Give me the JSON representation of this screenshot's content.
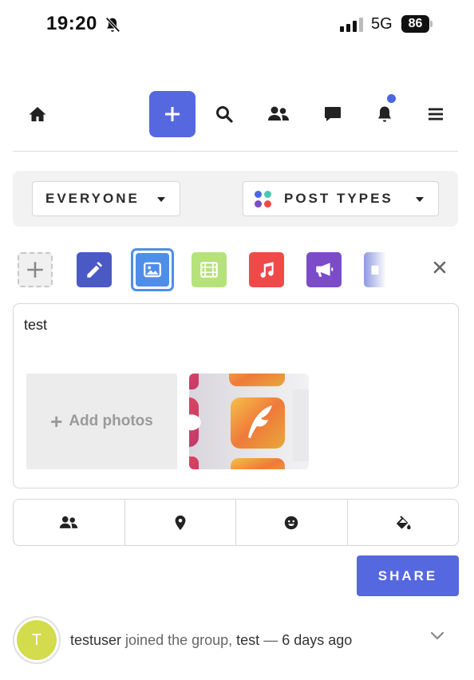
{
  "status_bar": {
    "time": "19:20",
    "network": "5G",
    "battery": "86"
  },
  "nav": {
    "items": [
      "home-icon",
      "plus-icon",
      "search-icon",
      "users-icon",
      "chat-icon",
      "bell-icon",
      "menu-icon"
    ],
    "notification_dot_color": "#4a66e6",
    "create_button_color": "#5568e0"
  },
  "filters": {
    "audience_label": "EVERYONE",
    "post_types_label": "POST TYPES"
  },
  "post_types": [
    {
      "name": "add",
      "color": "#f0f0f0"
    },
    {
      "name": "text",
      "color": "#4a59c4"
    },
    {
      "name": "photo",
      "color": "#4f8ee8",
      "selected": true
    },
    {
      "name": "video",
      "color": "#b6e27a"
    },
    {
      "name": "audio",
      "color": "#ef4a48"
    },
    {
      "name": "announcement",
      "color": "#7c4bc8"
    },
    {
      "name": "more",
      "color": "#9aa3e0"
    }
  ],
  "composer": {
    "text": "test",
    "add_photos_label": "Add photos"
  },
  "toolbar": [
    "users-icon",
    "location-pin-icon",
    "smiley-icon",
    "paint-bucket-icon"
  ],
  "share_label": "SHARE",
  "activity": {
    "avatar_initial": "T",
    "user": "testuser",
    "action": "joined the group,",
    "group": "test",
    "separator": "—",
    "time": "6 days ago"
  }
}
